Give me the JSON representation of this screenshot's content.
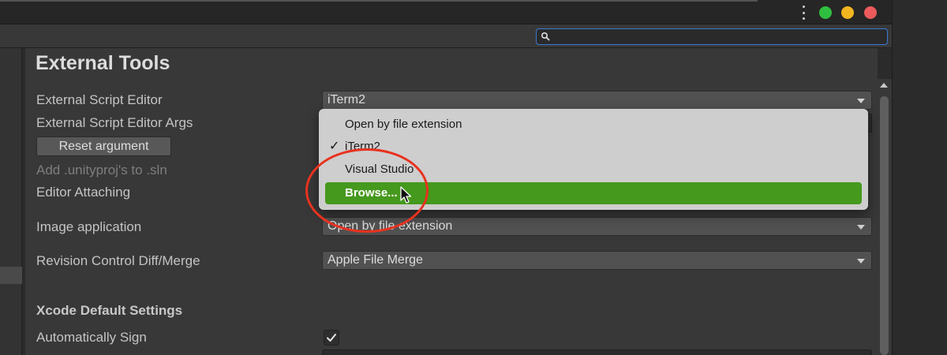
{
  "window": {
    "title_bar": {
      "icons": [
        "more-vertical-icon"
      ],
      "traffic_lights": [
        "green",
        "yellow",
        "red"
      ]
    },
    "search": {
      "placeholder": "",
      "value": ""
    }
  },
  "section": {
    "title": "External Tools"
  },
  "settings": {
    "external_script_editor": {
      "label": "External Script Editor",
      "value": "iTerm2"
    },
    "external_script_editor_args": {
      "label": "External Script Editor Args"
    },
    "reset_argument": {
      "label": "Reset argument"
    },
    "add_unityproj": {
      "label": "Add .unityproj's to .sln"
    },
    "editor_attaching": {
      "label": "Editor Attaching"
    },
    "image_application": {
      "label": "Image application",
      "value": "Open by file extension"
    },
    "revision_control": {
      "label": "Revision Control Diff/Merge",
      "value": "Apple File Merge"
    },
    "xcode_section": {
      "title": "Xcode Default Settings"
    },
    "automatically_sign": {
      "label": "Automatically Sign",
      "checked": true
    }
  },
  "dropdown_menu": {
    "items": [
      {
        "label": "Open by file extension",
        "checked": false,
        "highlighted": false
      },
      {
        "label": "iTerm2",
        "checked": true,
        "highlighted": false
      },
      {
        "label": "Visual Studio",
        "checked": false,
        "highlighted": false
      },
      {
        "label": "Browse...",
        "checked": false,
        "highlighted": true
      }
    ],
    "check_glyph": "✓"
  },
  "colors": {
    "highlight": "#45991d",
    "annotation_circle": "#e8321f",
    "search_focus": "#3a79d6",
    "traffic_green": "#2fbf3f",
    "traffic_yellow": "#f1b61f",
    "traffic_red": "#ec5b5b"
  }
}
